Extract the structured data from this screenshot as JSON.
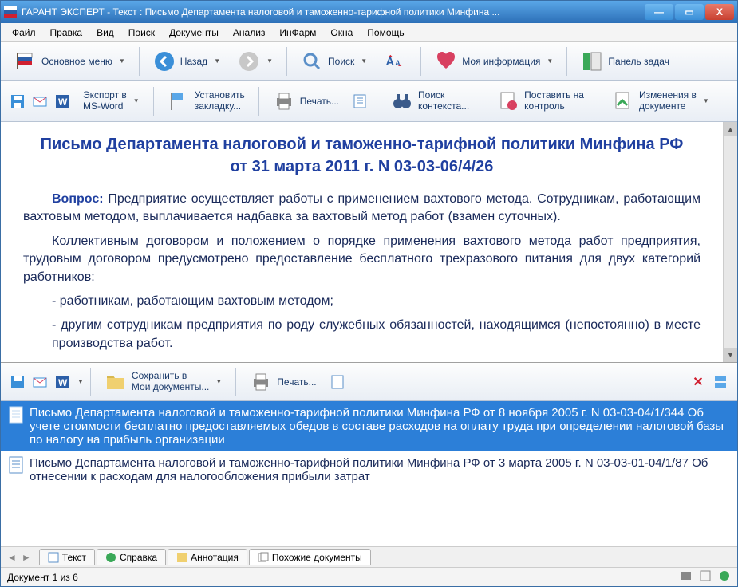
{
  "window": {
    "title": "ГАРАНТ ЭКСПЕРТ - Текст : Письмо Департамента налоговой и таможенно-тарифной политики Минфина ..."
  },
  "menubar": [
    "Файл",
    "Правка",
    "Вид",
    "Поиск",
    "Документы",
    "Анализ",
    "ИнФарм",
    "Окна",
    "Помощь"
  ],
  "toolbar1": {
    "main_menu": "Основное меню",
    "back": "Назад",
    "search": "Поиск",
    "my_info": "Моя информация",
    "task_panel": "Панель задач"
  },
  "toolbar2": {
    "export_word_l1": "Экспорт в",
    "export_word_l2": "MS-Word",
    "set_bookmark_l1": "Установить",
    "set_bookmark_l2": "закладку...",
    "print": "Печать...",
    "context_search_l1": "Поиск",
    "context_search_l2": "контекста...",
    "to_control_l1": "Поставить на",
    "to_control_l2": "контроль",
    "changes_l1": "Изменения в",
    "changes_l2": "документе"
  },
  "document": {
    "title_l1": "Письмо Департамента налоговой и таможенно-тарифной политики Минфина РФ",
    "title_l2": "от 31 марта 2011 г. N 03-03-06/4/26",
    "question_label": "Вопрос:",
    "p1": " Предприятие осуществляет работы с применением вахтового метода. Сотрудникам, работающим вахтовым методом, выплачивается надбавка за вахтовый метод работ (взамен суточных).",
    "p2": "Коллективным договором и положением о порядке применения вахтового метода работ предприятия, трудовым договором предусмотрено предоставление бесплатного трехразового питания для двух категорий работников:",
    "li1": "- работникам, работающим вахтовым методом;",
    "li2": "- другим сотрудникам предприятия по роду служебных обязанностей, находящимся (непостоянно) в месте производства работ."
  },
  "lower_toolbar": {
    "save_to_l1": "Сохранить в",
    "save_to_l2": "Мои документы...",
    "print": "Печать..."
  },
  "results": [
    "Письмо Департамента налоговой и таможенно-тарифной политики Минфина РФ от 8 ноября 2005 г. N 03-03-04/1/344 Об учете стоимости бесплатно предоставляемых обедов в составе расходов на оплату труда при определении налоговой базы по налогу на прибыль организации",
    "Письмо Департамента налоговой и таможенно-тарифной политики Минфина РФ от 3 марта 2005 г. N 03-03-01-04/1/87 Об отнесении к расходам для налогообложения прибыли затрат"
  ],
  "tabs": [
    "Текст",
    "Справка",
    "Аннотация",
    "Похожие документы"
  ],
  "statusbar": {
    "doc_pos": "Документ 1 из 6"
  }
}
